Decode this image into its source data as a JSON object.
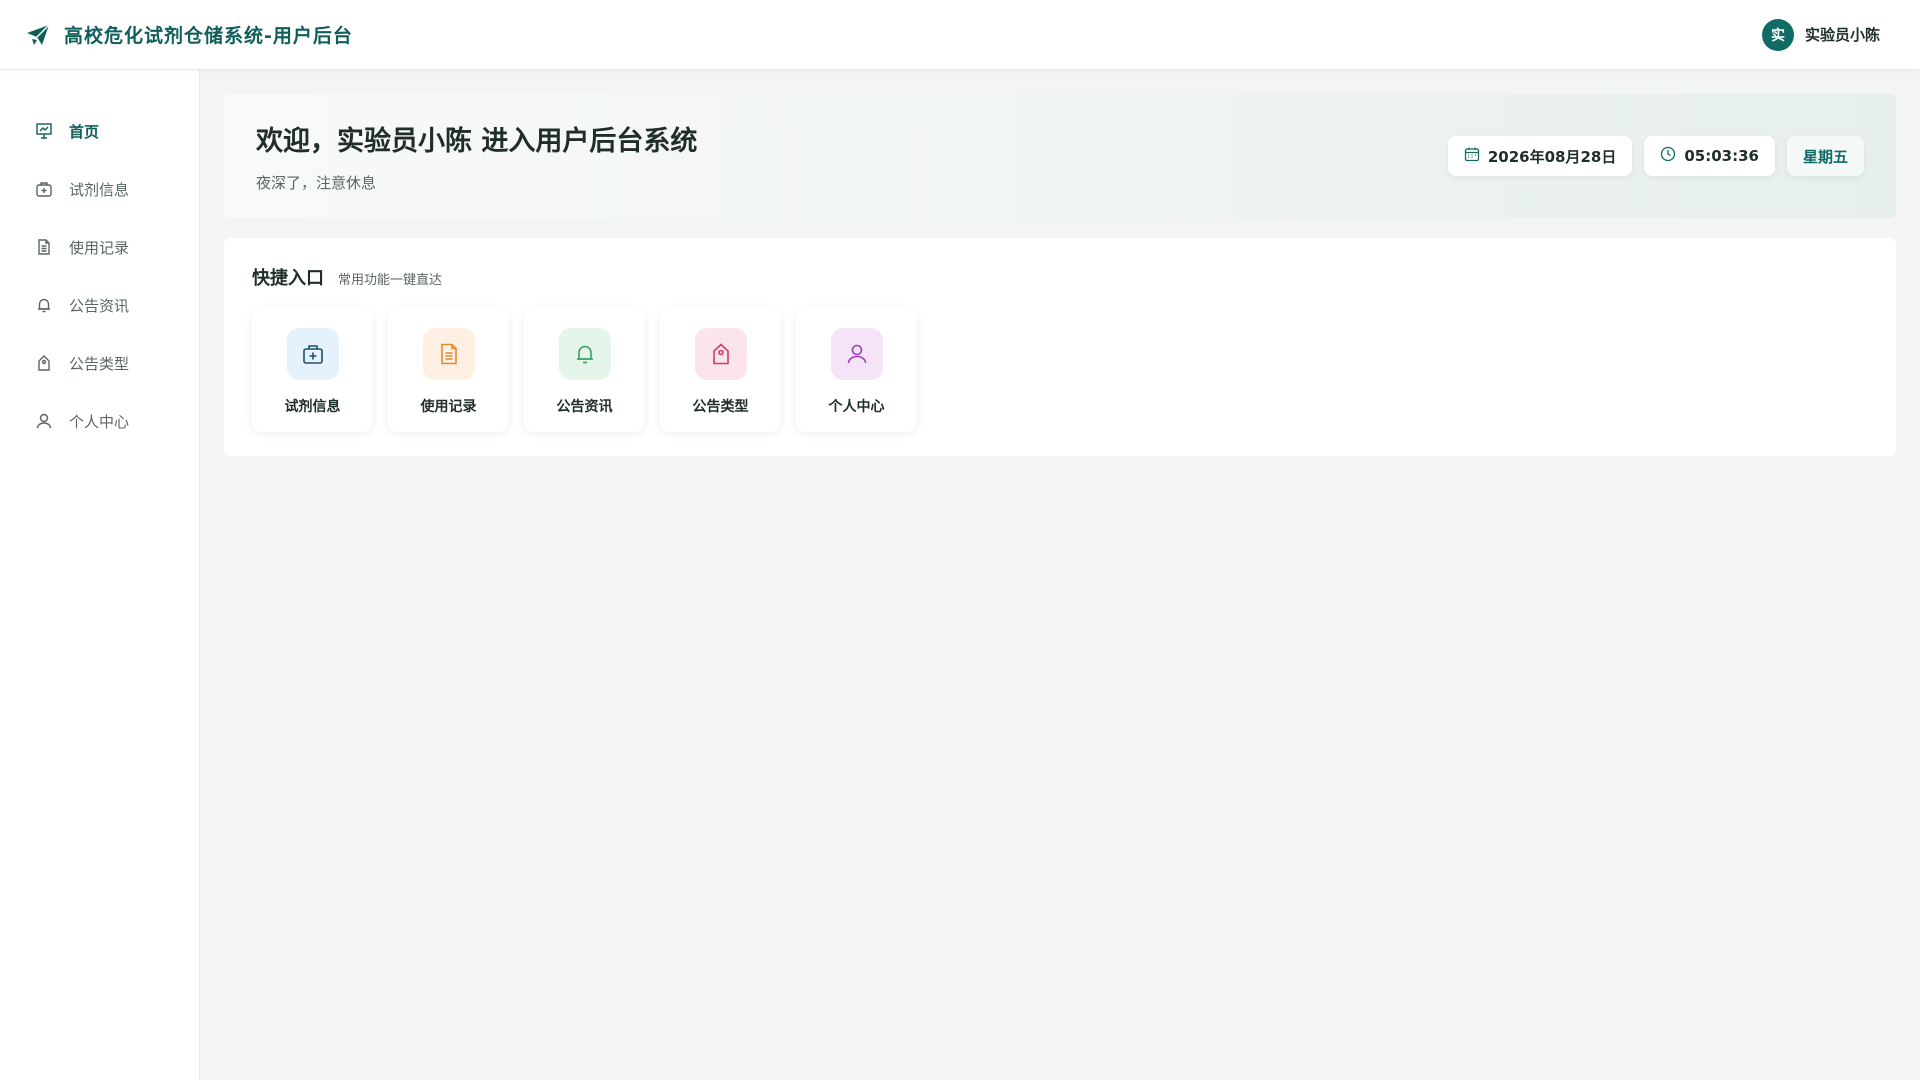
{
  "header": {
    "title": "高校危化试剂仓储系统-用户后台",
    "user_avatar_text": "实",
    "user_name": "实验员小陈"
  },
  "sidebar": {
    "items": [
      {
        "label": "首页",
        "icon": "presentation-icon",
        "active": true
      },
      {
        "label": "试剂信息",
        "icon": "medkit-icon"
      },
      {
        "label": "使用记录",
        "icon": "document-icon"
      },
      {
        "label": "公告资讯",
        "icon": "bell-icon"
      },
      {
        "label": "公告类型",
        "icon": "tag-icon"
      },
      {
        "label": "个人中心",
        "icon": "user-icon"
      }
    ]
  },
  "welcome": {
    "title": "欢迎，实验员小陈 进入用户后台系统",
    "subtitle": "夜深了，注意休息",
    "date": "2026年08月28日",
    "time": "05:03:36",
    "weekday": "星期五"
  },
  "quick": {
    "title": "快捷入口",
    "subtitle": "常用功能一键直达",
    "cards": [
      {
        "label": "试剂信息",
        "icon": "medkit-icon",
        "color": "#2a6f97",
        "bg": "#e6f2fb"
      },
      {
        "label": "使用记录",
        "icon": "document-icon",
        "color": "#e0892f",
        "bg": "#fdf0e2"
      },
      {
        "label": "公告资讯",
        "icon": "bell-icon",
        "color": "#3aa260",
        "bg": "#e5f5ea"
      },
      {
        "label": "公告类型",
        "icon": "tag-icon",
        "color": "#d23b6c",
        "bg": "#fbe4ec"
      },
      {
        "label": "个人中心",
        "icon": "user-icon",
        "color": "#9c3fb8",
        "bg": "#f5e4f8"
      }
    ]
  },
  "colors": {
    "brand": "#0f5e5a",
    "accent": "#0f6b63",
    "background": "#f3f5f4"
  }
}
